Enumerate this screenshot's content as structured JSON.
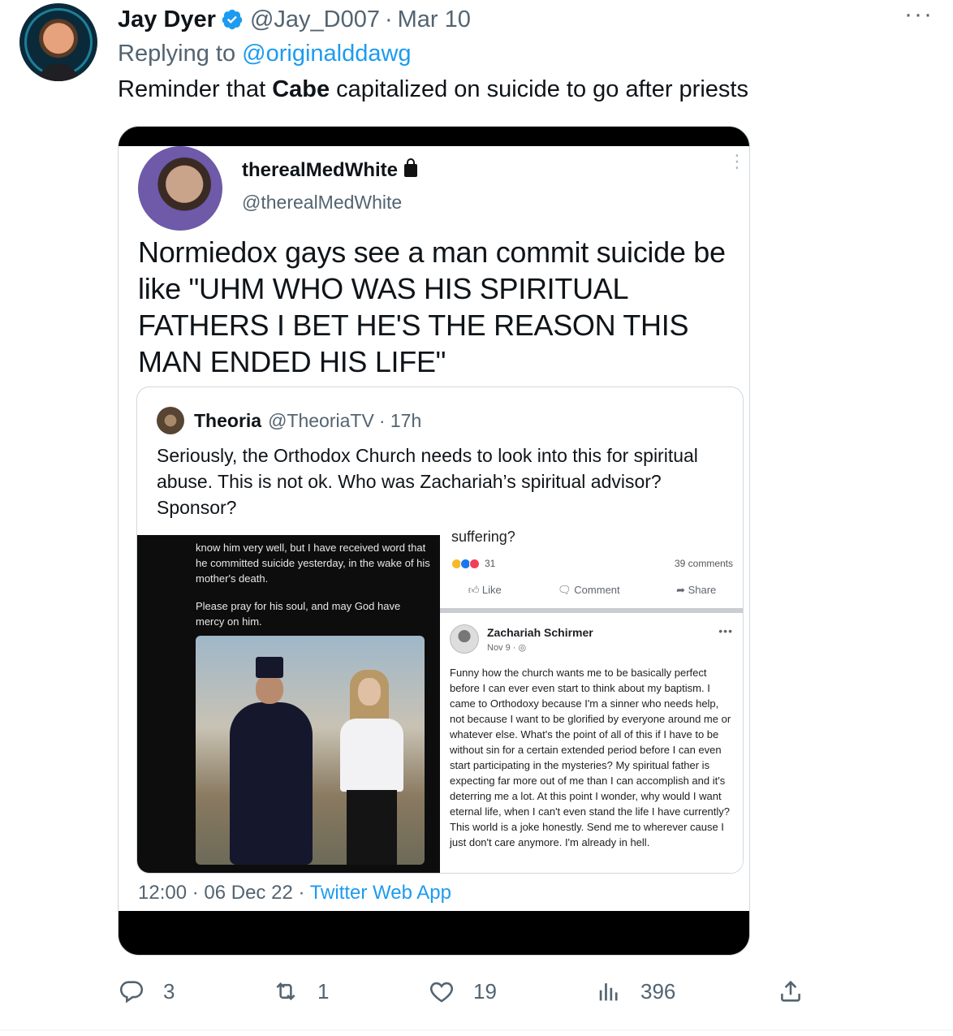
{
  "tweet": {
    "author_name": "Jay Dyer",
    "author_handle": "@Jay_D007",
    "separator": "·",
    "date": "Mar 10",
    "more_label": "···",
    "reply_prefix": "Replying to ",
    "reply_to": "@originalddawg",
    "text_before": "Reminder that ",
    "text_bold": "Cabe",
    "text_after": " capitalized on suicide to go after priests"
  },
  "embedded": {
    "name": "therealMedWhite",
    "handle": "@therealMedWhite",
    "kebab": "⋮",
    "text": "Normiedox gays see a man commit suicide be like \"UHM WHO WAS HIS SPIRITUAL FATHERS I BET HE'S THE REASON THIS MAN ENDED HIS LIFE\"",
    "quote": {
      "name": "Theoria",
      "handle": "@TheoriaTV",
      "time": "· 17h",
      "text": "Seriously, the Orthodox Church needs to look into this for spiritual abuse. This is not ok. Who was Zachariah’s spiritual advisor? Sponsor?",
      "fb_left_text": "know him very well, but I have received word that he committed suicide yesterday, in the wake of his mother's death.",
      "fb_left_text2": "Please pray for his soul, and may God have mercy on him.",
      "fb_suffering": "suffering?",
      "fb_reactions": "31",
      "fb_comments": "39 comments",
      "fb_like": "Like",
      "fb_comment": "Comment",
      "fb_share": "Share",
      "fb_post_name": "Zachariah Schirmer",
      "fb_post_date": "Nov 9 · ◎",
      "fb_post_more": "•••",
      "fb_post_text": "Funny how the church wants me to be basically perfect before I can ever even start to think about my baptism. I came to Orthodoxy because I'm a sinner who needs help, not because I want to be glorified by everyone around me or whatever else. What's the point of all of this if I have to be without sin for a certain extended period before I can even start participating in the mysteries? My spiritual father is expecting far more out of me than I can accomplish and it's deterring me a lot. At this point I wonder, why would I want eternal life, when I can't even stand the life I have currently? This world is a joke honestly. Send me to wherever cause I just don't care anymore. I'm already in hell."
    },
    "footer_time": "12:00 · 06 Dec 22 · ",
    "footer_app": "Twitter Web App"
  },
  "actions": {
    "replies": "3",
    "retweets": "1",
    "likes": "19",
    "views": "396"
  },
  "colors": {
    "accent": "#1d9bf0",
    "muted": "#536471",
    "text": "#0f1419"
  },
  "icons": [
    "verified-badge-icon",
    "reply-icon",
    "retweet-icon",
    "like-icon",
    "views-icon",
    "share-icon",
    "lock-icon"
  ]
}
